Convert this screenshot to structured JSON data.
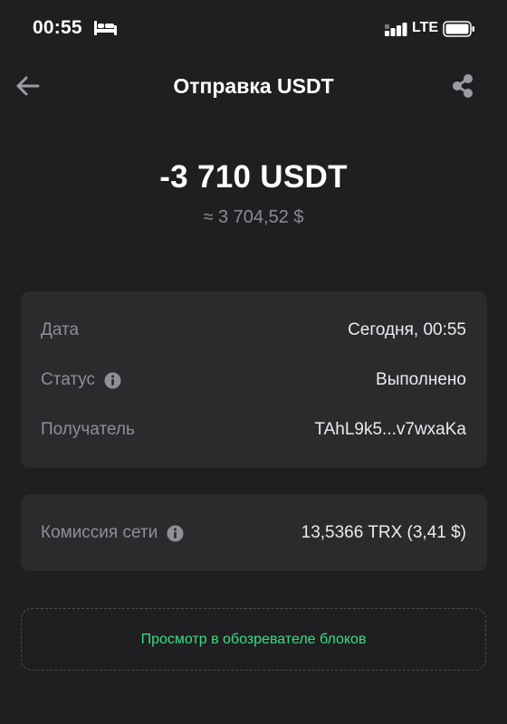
{
  "status_bar": {
    "time": "00:55",
    "network": "LTE",
    "icons": [
      "bed-icon",
      "signal-icon",
      "battery-icon"
    ]
  },
  "header": {
    "title": "Отправка USDT",
    "back_icon": "arrow-left-icon",
    "share_icon": "share-icon"
  },
  "transaction": {
    "amount": "-3 710 USDT",
    "fiat_approx": "≈ 3 704,52 $"
  },
  "details": {
    "date_label": "Дата",
    "date_value": "Сегодня, 00:55",
    "status_label": "Статус",
    "status_value": "Выполнено",
    "recipient_label": "Получатель",
    "recipient_value": "TAhL9k5...v7wxaKa"
  },
  "fee": {
    "label": "Комиссия сети",
    "value": "13,5366 TRX (3,41 $)"
  },
  "explorer": {
    "label": "Просмотр в обозревателе блоков"
  },
  "colors": {
    "background": "#1f1f21",
    "card": "#2b2b2e",
    "label": "#8e9097",
    "accent": "#3ddc84"
  }
}
